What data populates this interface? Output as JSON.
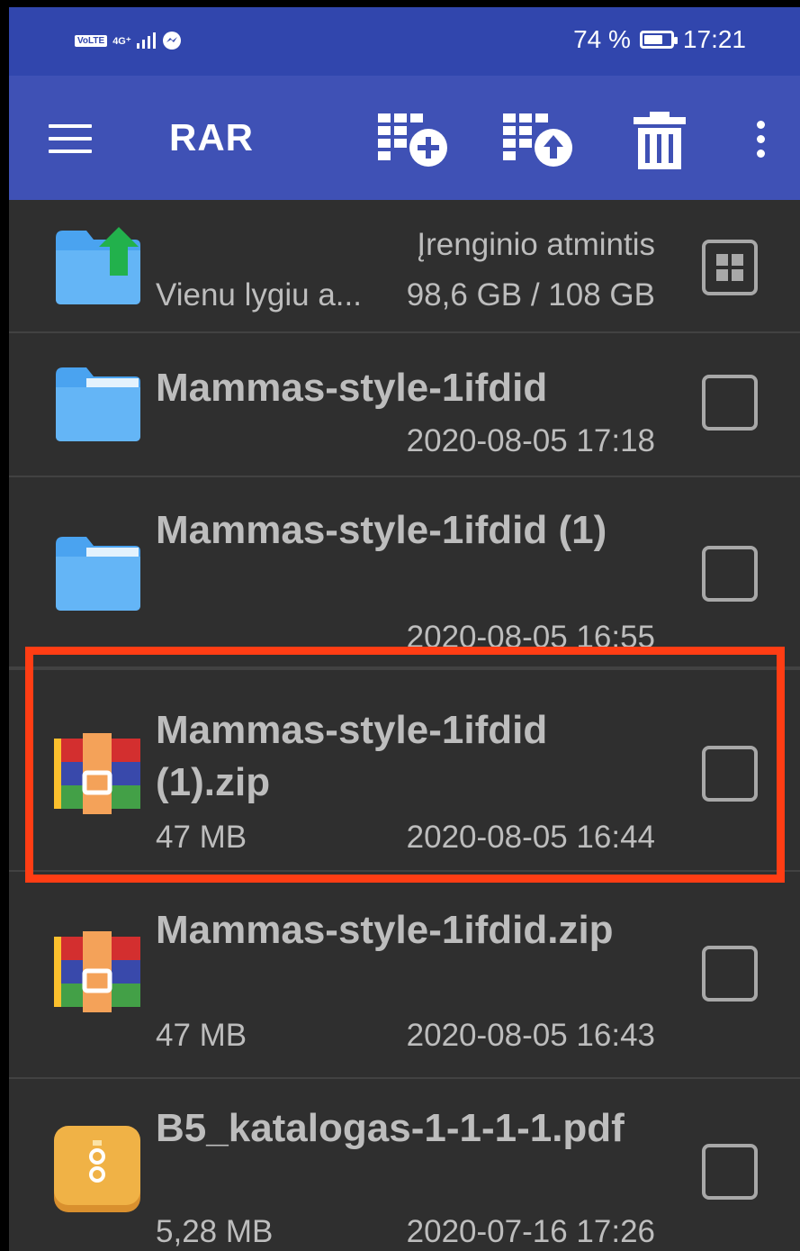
{
  "status_bar": {
    "volte": "VoLTE",
    "network": "4G⁺",
    "battery_percent": "74 %",
    "battery_level": 0.74,
    "time": "17:21"
  },
  "app_bar": {
    "title": "RAR",
    "icons": [
      "menu-icon",
      "archive-add-icon",
      "archive-extract-icon",
      "delete-icon",
      "more-vert-icon"
    ]
  },
  "storage": {
    "label": "Įrenginio atmintis",
    "up_label": "Vienu lygiu a...",
    "usage": "98,6 GB / 108 GB"
  },
  "files": [
    {
      "name": "Mammas-style-1ifdid",
      "size": "",
      "date": "2020-08-05 17:18",
      "icon": "folder-icon"
    },
    {
      "name": "Mammas-style-1ifdid (1)",
      "size": "",
      "date": "2020-08-05 16:55",
      "icon": "folder-icon"
    },
    {
      "name": "Mammas-style-1ifdid (1).zip",
      "size": "47 MB",
      "date": "2020-08-05 16:44",
      "icon": "rar-archive-icon"
    },
    {
      "name": "Mammas-style-1ifdid.zip",
      "size": "47 MB",
      "date": "2020-08-05 16:43",
      "icon": "rar-archive-icon"
    },
    {
      "name": "B5_katalogas-1-1-1-1.pdf",
      "size": "5,28 MB",
      "date": "2020-07-16 17:26",
      "icon": "pdf-document-icon"
    }
  ],
  "colors": {
    "status_bar": "#3146ad",
    "app_bar": "#3f51b5",
    "background": "#2f2f2f",
    "highlight": "#ff3d14",
    "text": "#bdbdbd"
  }
}
